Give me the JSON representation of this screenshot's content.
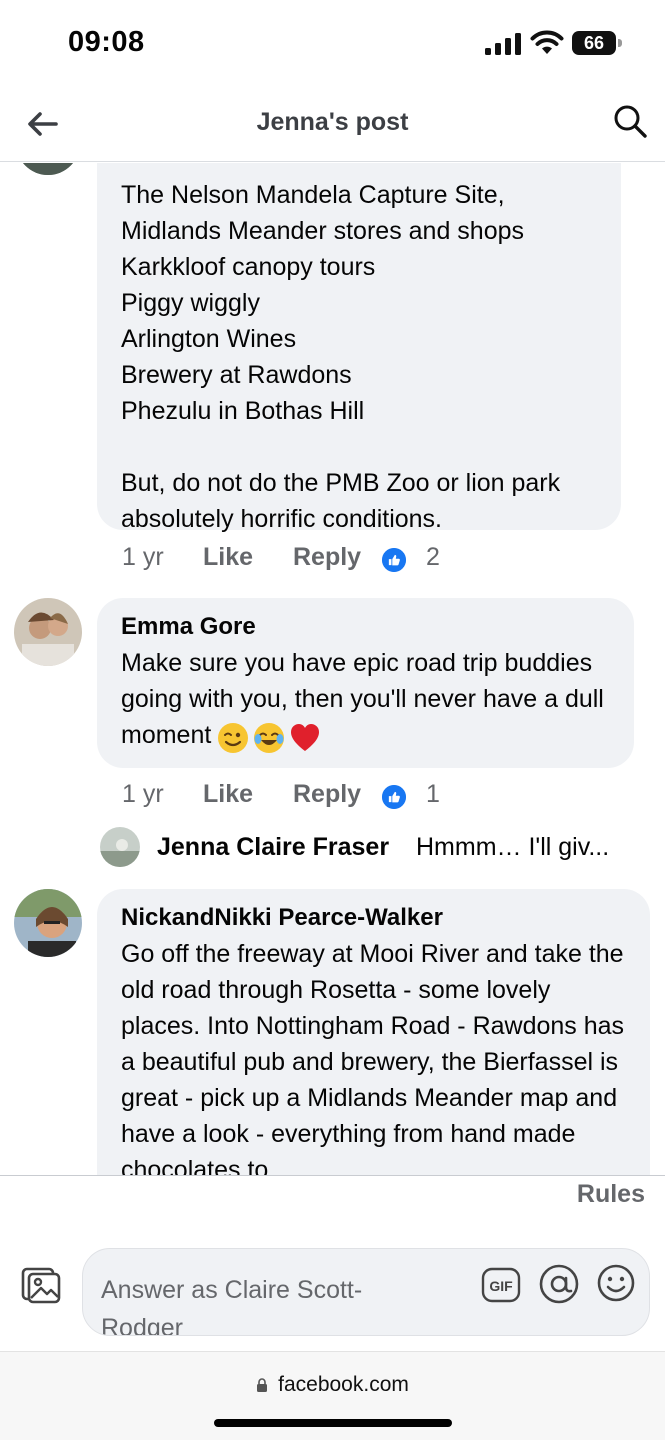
{
  "status_bar": {
    "time": "09:08",
    "battery": "66"
  },
  "header": {
    "title": "Jenna's post"
  },
  "comments": [
    {
      "author": "",
      "text": "The Nelson Mandela Capture Site,\nMidlands Meander stores and shops\nKarkkloof canopy tours\nPiggy wiggly\nArlington Wines\nBrewery at Rawdons\nPhezulu in Bothas Hill\n\nBut, do not do the PMB Zoo or lion park absolutely horrific conditions.",
      "time": "1 yr",
      "like_label": "Like",
      "reply_label": "Reply",
      "reaction_count": "2"
    },
    {
      "author": "Emma Gore",
      "text": "Make sure you have epic road trip buddies going with you, then you'll never have a dull moment",
      "emojis": [
        "winking-face-emoji",
        "tears-of-joy-emoji",
        "red-heart-emoji"
      ],
      "time": "1 yr",
      "like_label": "Like",
      "reply_label": "Reply",
      "reaction_count": "1",
      "reply_preview": {
        "author": "Jenna Claire Fraser",
        "snippet": "Hmmm… I'll giv..."
      }
    },
    {
      "author": "NickandNikki Pearce-Walker",
      "text": "Go off the freeway at Mooi River and take the old road through Rosetta - some lovely places. Into Nottingham Road - Rawdons has a beautiful pub and brewery, the Bierfassel is great - pick up a Midlands Meander map and have a look - everything from hand made chocolates to"
    }
  ],
  "composer": {
    "rules_label": "Rules",
    "placeholder": "Answer as Claire Scott-Rodger"
  },
  "browser": {
    "url": "facebook.com"
  },
  "colors": {
    "facebook_blue": "#1877f2",
    "bubble_bg": "#f0f2f5",
    "meta_gray": "#65676b"
  }
}
